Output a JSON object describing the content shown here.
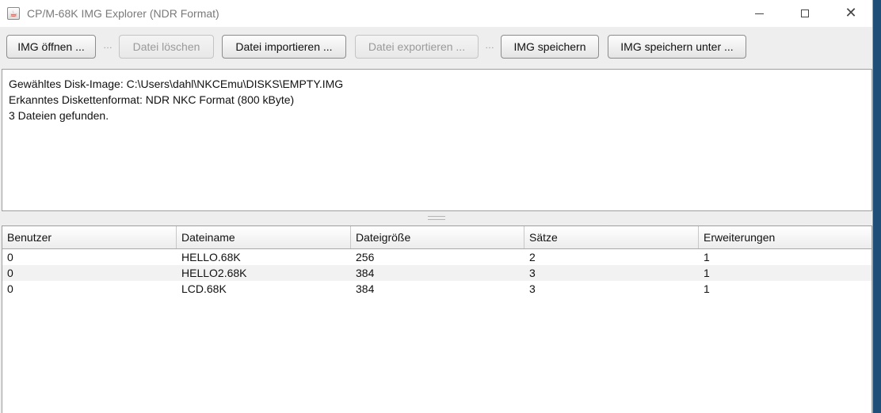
{
  "window": {
    "title": "CP/M-68K IMG Explorer (NDR Format)"
  },
  "toolbar": {
    "open_label": "IMG öffnen ...",
    "delete_label": "Datei löschen",
    "import_label": "Datei importieren ...",
    "export_label": "Datei exportieren ...",
    "save_label": "IMG speichern",
    "save_as_label": "IMG speichern unter ...",
    "separator": "…"
  },
  "info": {
    "line1": "Gewähltes Disk-Image: C:\\Users\\dahl\\NKCEmu\\DISKS\\EMPTY.IMG",
    "line2": "Erkanntes Diskettenformat: NDR NKC Format (800 kByte)",
    "line3": "3 Dateien gefunden."
  },
  "table": {
    "columns": [
      "Benutzer",
      "Dateiname",
      "Dateigröße",
      "Sätze",
      "Erweiterungen"
    ],
    "rows": [
      [
        "0",
        "HELLO.68K",
        "256",
        "2",
        "1"
      ],
      [
        "0",
        "HELLO2.68K",
        "384",
        "3",
        "1"
      ],
      [
        "0",
        "LCD.68K",
        "384",
        "3",
        "1"
      ]
    ]
  },
  "colors": {
    "window_bg": "#eeeeee",
    "panel_bg": "#ffffff",
    "alt_row": "#f2f2f2",
    "disabled_text": "#9a9a9a"
  }
}
